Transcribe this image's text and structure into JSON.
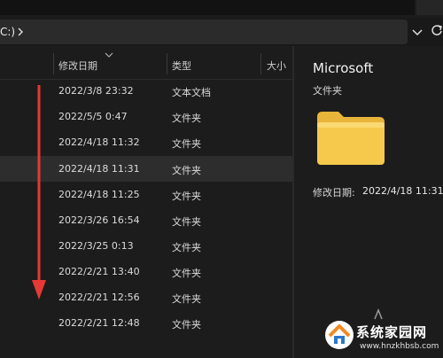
{
  "address": {
    "crumb": "C:)"
  },
  "columns": {
    "modified": "修改日期",
    "type": "类型",
    "size": "大小"
  },
  "rows": [
    {
      "date": "2022/3/8 23:32",
      "type": "文本文档",
      "selected": false
    },
    {
      "date": "2022/5/5 0:47",
      "type": "文件夹",
      "selected": false
    },
    {
      "date": "2022/4/18 11:32",
      "type": "文件夹",
      "selected": false
    },
    {
      "date": "2022/4/18 11:31",
      "type": "文件夹",
      "selected": true
    },
    {
      "date": "2022/4/18 11:25",
      "type": "文件夹",
      "selected": false
    },
    {
      "date": "2022/3/26 16:54",
      "type": "文件夹",
      "selected": false
    },
    {
      "date": "2022/3/25 0:13",
      "type": "文件夹",
      "selected": false
    },
    {
      "date": "2022/2/21 13:40",
      "type": "文件夹",
      "selected": false
    },
    {
      "date": "2022/2/21 12:56",
      "type": "文件夹",
      "selected": false
    },
    {
      "date": "2022/2/21 12:48",
      "type": "文件夹",
      "selected": false
    }
  ],
  "details": {
    "name": "Microsoft",
    "kind": "文件夹",
    "modified_label": "修改日期:",
    "modified_value": "2022/4/18 11:31"
  },
  "watermark": {
    "site_name": "系统家园网",
    "url": "www.hnzkhbsb.com"
  },
  "icons": {
    "chevron": "chevron-right-icon",
    "dropdown": "chevron-down-icon",
    "refresh": "refresh-icon",
    "folder": "folder-icon",
    "arrow": "down-arrow-annotation-icon",
    "logo": "house-logo-icon"
  },
  "colors": {
    "background": "#191919",
    "selected_row": "#2d2d2d",
    "annotation_arrow": "#e53935",
    "folder_yellow": "#f6c94c"
  }
}
